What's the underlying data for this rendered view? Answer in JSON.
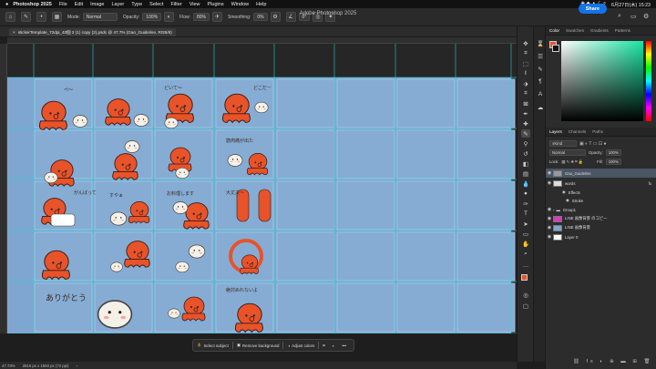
{
  "menubar": {
    "app": "Photoshop 2025",
    "items": [
      "File",
      "Edit",
      "Image",
      "Layer",
      "Type",
      "Select",
      "Filter",
      "View",
      "Plugins",
      "Window",
      "Help"
    ],
    "datetime": "6月27日(木)  15:23"
  },
  "window_title": "Adobe Photoshop 2025",
  "options_bar": {
    "mode_label": "Mode:",
    "mode_value": "Normal",
    "opacity_label": "Opacity:",
    "opacity_value": "100%",
    "flow_label": "Flow:",
    "flow_value": "80%",
    "smoothing_label": "Smoothing:",
    "smoothing_value": "0%",
    "angle_value": "0°",
    "share_label": "Share"
  },
  "document_tab": {
    "title": "stickerTemplate_72dpi_40個 2 (1) copy (2).psdc @ 47.7% (Gao_Guideline, RGB/8)"
  },
  "taskbar": {
    "select_subject": "Select subject",
    "remove_background": "Remove background",
    "adjust_colors": "Adjust colors"
  },
  "status": {
    "zoom": "47.73%",
    "doc_size": "2816 px x 1560 px (72 ppi)"
  },
  "color_panel": {
    "tabs": [
      "Color",
      "Swatches",
      "Gradients",
      "Patterns"
    ]
  },
  "layers_panel": {
    "tabs": [
      "Layers",
      "Channels",
      "Paths"
    ],
    "kind_label": "Kind",
    "blend_mode": "Normal",
    "opacity_label": "Opacity:",
    "opacity_value": "100%",
    "lock_label": "Lock:",
    "fill_label": "Fill:",
    "fill_value": "100%",
    "layers": [
      {
        "name": "Gao_Guideline",
        "selected": true
      },
      {
        "name": "words"
      },
      {
        "name": "Effects"
      },
      {
        "name": "Stroke"
      },
      {
        "name": "Group1"
      },
      {
        "name": "LINE 画像背景 のコピー"
      },
      {
        "name": "LINE 画像背景"
      },
      {
        "name": "Layer 0"
      }
    ]
  },
  "canvas_text": {
    "cell_1_1": "ぺ〜",
    "cell_1_3": "どいて〜",
    "cell_1_4": "どこだー",
    "cell_2_4": "筋肉痛が出た",
    "cell_3_1": "がんばって",
    "cell_3_2": "すやぁ",
    "cell_3_3": "お料理します",
    "cell_3_4": "大丈夫〜",
    "cell_5_1": "ありがとう",
    "cell_5_4": "絶対ぬれないよ"
  },
  "accent_colors": {
    "octopus": "#e8532a",
    "background": "#7ea6d1",
    "guide": "#2dd5d5",
    "share": "#1473e6"
  }
}
